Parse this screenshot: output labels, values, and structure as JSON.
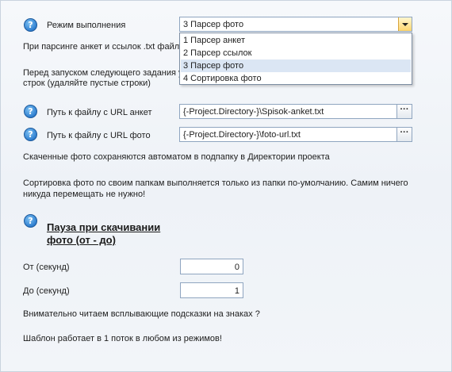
{
  "mode": {
    "label": "Режим выполнения",
    "selected": "3 Парсер фото",
    "options": [
      "1 Парсер анкет",
      "2 Парсер ссылок",
      "3 Парсер фото",
      "4 Сортировка фото"
    ]
  },
  "notes": {
    "parsing_txt": "При парсинге анкет и ссылок .txt файл",
    "before_start_line1": "Перед запуском следующего задания у",
    "before_start_line2": "строк (удаляйте пустые строки)",
    "saved_photos": "Скаченные фото сохраняются автоматом в подпапку в Директории проекта",
    "sort_line1": "Сортировка фото по своим папкам выполняется только из папки по-умолчанию. Самим ничего",
    "sort_line2": "никуда перемещать не нужно!",
    "read_tips": "Внимательно читаем всплывающие подсказки на знаках ?",
    "single_thread": "Шаблон работает в 1 поток в любом из режимов!"
  },
  "url_anket": {
    "label": "Путь к файлу с URL анкет",
    "value": "{-Project.Directory-}\\Spisok-anket.txt",
    "browse": "···"
  },
  "url_photo": {
    "label": "Путь к файлу с URL фото",
    "value": "{-Project.Directory-}\\foto-url.txt",
    "browse": "···"
  },
  "pause": {
    "heading_line1": "Пауза при скачивании",
    "heading_line2": "фото (от - до)",
    "from_label": "От (секунд)",
    "from_value": "0",
    "to_label": "До (секунд)",
    "to_value": "1"
  },
  "help_icon": "?"
}
